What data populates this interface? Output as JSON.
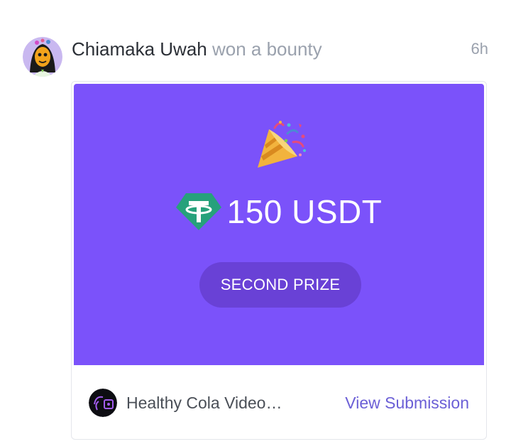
{
  "activity": {
    "user_name": "Chiamaka Uwah",
    "action": "won a bounty",
    "time_ago": "6h"
  },
  "prize": {
    "amount": "150 USDT",
    "rank": "SECOND PRIZE",
    "panel_color": "#7b52fa",
    "badge_color": "#6941d6",
    "celebration_icon": "party-popper-icon",
    "token_icon": "tether-usdt-icon",
    "token_color": "#26a17b"
  },
  "submission": {
    "title": "Healthy Cola Video…",
    "link_label": "View Submission",
    "link_color": "#6b5fd6"
  }
}
